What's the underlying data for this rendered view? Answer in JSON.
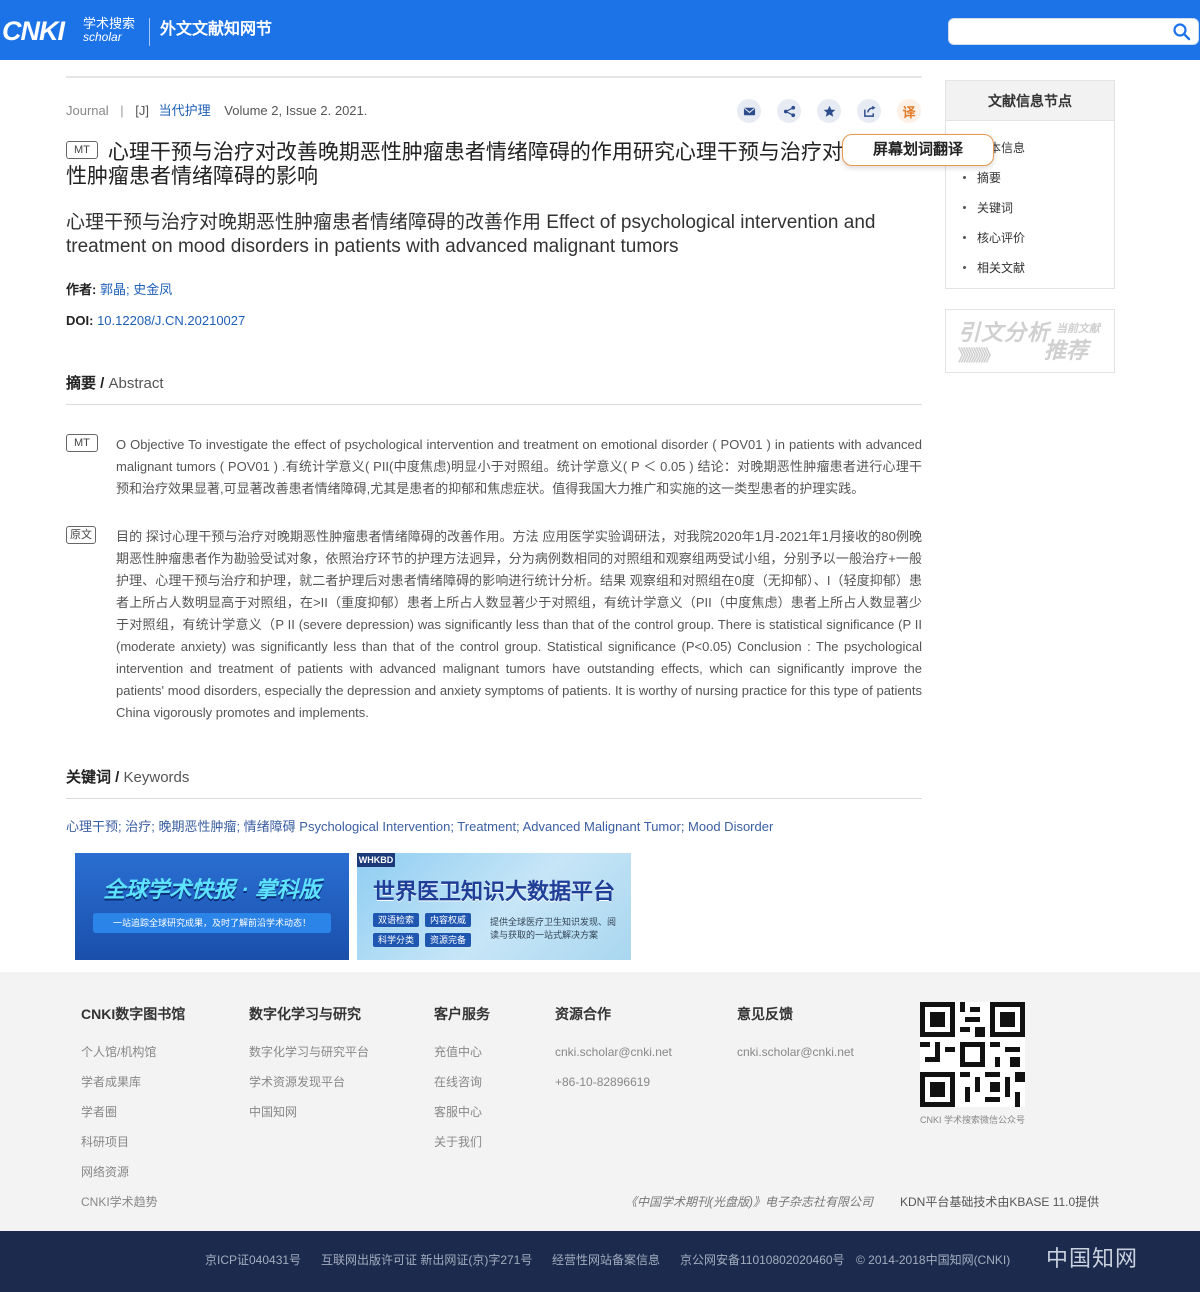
{
  "header": {
    "logo_cnki": "CNKI",
    "logo_cn": "学术搜索",
    "logo_en": "scholar",
    "site_name": "外文文献知网节",
    "search_placeholder": "",
    "brand_color": "#1c73e8"
  },
  "article": {
    "meta": {
      "type": "Journal",
      "divider": "|",
      "code": "[J]",
      "journal": "当代护理",
      "issue": "Volume 2, Issue 2. 2021."
    },
    "tools": [
      {
        "name": "email-icon"
      },
      {
        "name": "share-icon"
      },
      {
        "name": "star-icon"
      },
      {
        "name": "export-icon"
      },
      {
        "name": "translate-icon",
        "label": "译"
      }
    ],
    "tooltip": "屏幕划词翻译",
    "mt_badge": "MT",
    "title": "心理干预与治疗对改善晚期恶性肿瘤患者情绪障碍的作用研究心理干预与治疗对晚期恶性肿瘤患者情绪障碍的影响",
    "subtitle": "心理干预与治疗对晚期恶性肿瘤患者情绪障碍的改善作用 Effect of psychological intervention and treatment on mood disorders in patients with advanced malignant tumors",
    "authors_label": "作者:",
    "authors": "郭晶; 史金凤",
    "doi_label": "DOI:",
    "doi": "10.12208/J.CN.20210027",
    "abstract_head_cn": "摘要 / ",
    "abstract_head_en": "Abstract",
    "abstract_mt_badge": "MT",
    "abstract_mt": "O Objective To investigate the effect of psychological intervention and treatment on emotional disorder ( POV01 ) in patients with advanced malignant tumors ( POV01 ) .有统计学意义( PII(中度焦虑)明显小于对照组。统计学意义( P ＜ 0.05 ) 结论：对晚期恶性肿瘤患者进行心理干预和治疗效果显著,可显著改善患者情绪障碍,尤其是患者的抑郁和焦虑症状。值得我国大力推广和实施的这一类型患者的护理实践。",
    "abstract_orig_badge": "原文",
    "abstract_orig": "目的  探讨心理干预与治疗对晚期恶性肿瘤患者情绪障碍的改善作用。方法  应用医学实验调研法，对我院2020年1月-2021年1月接收的80例晚期恶性肿瘤患者作为勘验受试对象，依照治疗环节的护理方法迥异，分为病例数相同的对照组和观察组两受试小组，分别予以一般治疗+一般护理、心理干预与治疗和护理，就二者护理后对患者情绪障碍的影响进行统计分析。结果  观察组和对照组在0度（无抑郁）、I（轻度抑郁）患者上所占人数明显高于对照组，在>II（重度抑郁）患者上所占人数显著少于对照组，有统计学意义（PII（中度焦虑）患者上所占人数显著少于对照组，有统计学意义（P II (severe depression) was significantly less than that of the control group. There is statistical significance (P II (moderate anxiety) was significantly less than that of the control group. Statistical significance (P<0.05) Conclusion : The psychological intervention and treatment of patients with advanced malignant tumors have outstanding effects, which can significantly improve the patients' mood disorders, especially the depression and anxiety symptoms of patients. It is worthy of nursing practice for this type of patients China vigorously promotes and implements.",
    "keywords_head_cn": "关键词 / ",
    "keywords_head_en": "Keywords",
    "keywords": "心理干预; 治疗; 晚期恶性肿瘤; 情绪障碍 Psychological Intervention; Treatment; Advanced Malignant Tumor; Mood Disorder",
    "link_color": "#1f5fb8"
  },
  "banners": {
    "b1_title": "全球学术快报 · 掌科版",
    "b1_strip": "一站追踪全球研究成果，及时了解前沿学术动态！",
    "b2_tag": "WHKBD",
    "b2_title": "世界医卫知识大数据平台",
    "b2_chips": [
      "双语检索",
      "内容权威",
      "科学分类",
      "资源完备"
    ],
    "b2_desc": "提供全球医疗卫生知识发现、阅读与获取的一站式解决方案"
  },
  "sidebar": {
    "nav_title": "文献信息节点",
    "nav_items": [
      "基本信息",
      "摘要",
      "关键词",
      "核心评价",
      "相关文献"
    ],
    "cite_main": "引文分析",
    "cite_small": "当前文献",
    "cite_rec": "推荐",
    "cite_arrows": "》》》》》》"
  },
  "footer": {
    "columns": [
      {
        "head": "CNKI数字图书馆",
        "links": [
          "个人馆/机构馆",
          "学者成果库",
          "学者圈",
          "科研项目",
          "网络资源",
          "CNKI学术趋势"
        ]
      },
      {
        "head": "数字化学习与研究",
        "links": [
          "数字化学习与研究平台",
          "学术资源发现平台",
          "中国知网"
        ]
      },
      {
        "head": "客户服务",
        "links": [
          "充值中心",
          "在线咨询",
          "客服中心",
          "关于我们"
        ]
      },
      {
        "head": "资源合作",
        "links": [
          "cnki.scholar@cnki.net",
          "+86-10-82896619"
        ]
      },
      {
        "head": "意见反馈",
        "links": [
          "cnki.scholar@cnki.net"
        ]
      }
    ],
    "qr_caption": "CNKI 学术搜索微信公众号",
    "publisher": "《中国学术期刊(光盘版)》电子杂志社有限公司",
    "kdn": "KDN平台基础技术由KBASE 11.0提供",
    "bottom": [
      "京ICP证040431号",
      "互联网出版许可证 新出网证(京)字271号",
      "经营性网站备案信息",
      "京公网安备11010802020460号",
      "© 2014-2018中国知网(CNKI)"
    ],
    "seal": "中国知网"
  }
}
